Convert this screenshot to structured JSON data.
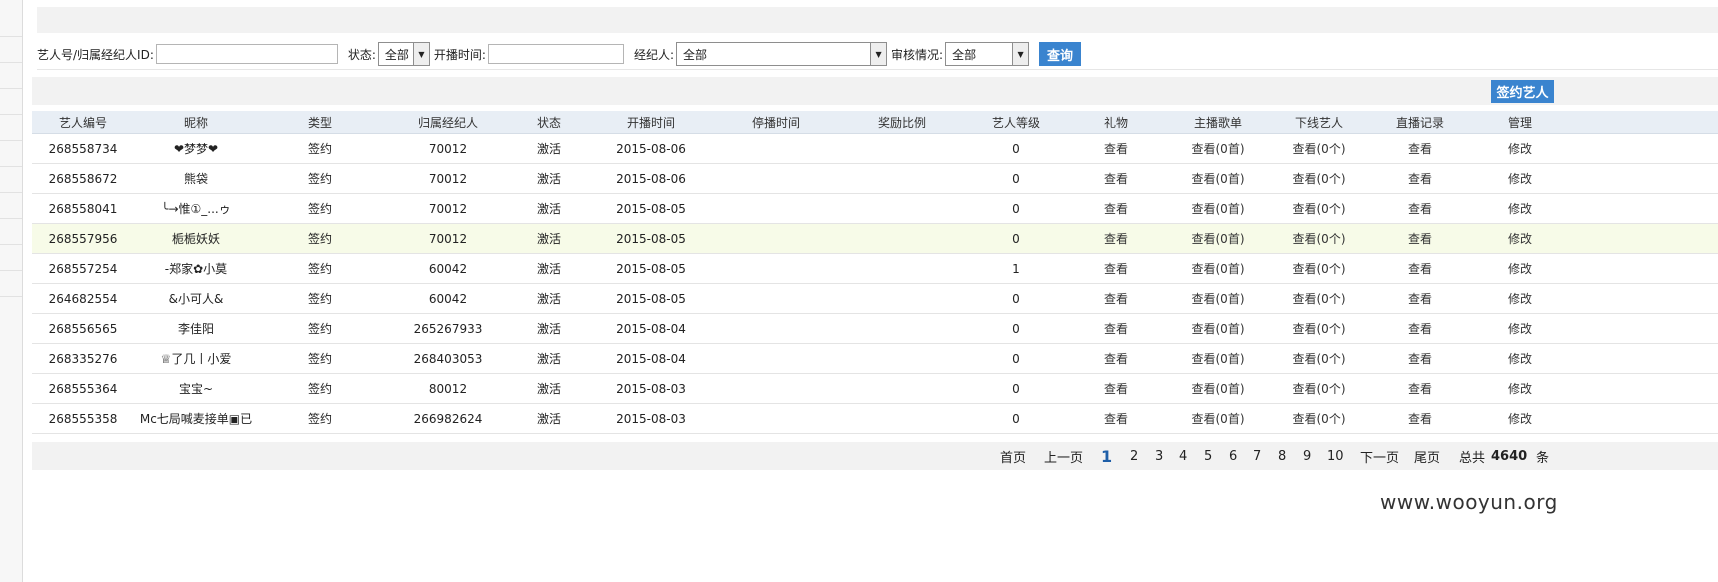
{
  "filters": {
    "artist_id_label": "艺人号/归属经纪人ID:",
    "artist_id_value": "",
    "status_label": "状态:",
    "status_value": "全部",
    "start_time_label": "开播时间:",
    "start_time_value": "",
    "agent_label": "经纪人:",
    "agent_value": "全部",
    "review_label": "审核情况:",
    "review_value": "全部",
    "query_label": "查询"
  },
  "actions": {
    "sign_artist_label": "签约艺人"
  },
  "table": {
    "headers": [
      "艺人编号",
      "昵称",
      "类型",
      "归属经纪人",
      "状态",
      "开播时间",
      "停播时间",
      "奖励比例",
      "艺人等级",
      "礼物",
      "主播歌单",
      "下线艺人",
      "直播记录",
      "管理"
    ],
    "rows": [
      [
        "268558734",
        "❤梦梦❤",
        "签约",
        "70012",
        "激活",
        "2015-08-06",
        "",
        "",
        "0",
        "查看",
        "查看(0首)",
        "查看(0个)",
        "查看",
        "修改"
      ],
      [
        "268558672",
        "熊袋",
        "签约",
        "70012",
        "激活",
        "2015-08-06",
        "",
        "",
        "0",
        "查看",
        "查看(0首)",
        "查看(0个)",
        "查看",
        "修改"
      ],
      [
        "268558041",
        "╰→惟①_...ゥ",
        "签约",
        "70012",
        "激活",
        "2015-08-05",
        "",
        "",
        "0",
        "查看",
        "查看(0首)",
        "查看(0个)",
        "查看",
        "修改"
      ],
      [
        "268557956",
        "栀栀妖妖",
        "签约",
        "70012",
        "激活",
        "2015-08-05",
        "",
        "",
        "0",
        "查看",
        "查看(0首)",
        "查看(0个)",
        "查看",
        "修改"
      ],
      [
        "268557254",
        "-郑家✿小莫",
        "签约",
        "60042",
        "激活",
        "2015-08-05",
        "",
        "",
        "1",
        "查看",
        "查看(0首)",
        "查看(0个)",
        "查看",
        "修改"
      ],
      [
        "264682554",
        "&小可人&",
        "签约",
        "60042",
        "激活",
        "2015-08-05",
        "",
        "",
        "0",
        "查看",
        "查看(0首)",
        "查看(0个)",
        "查看",
        "修改"
      ],
      [
        "268556565",
        "李佳阳",
        "签约",
        "265267933",
        "激活",
        "2015-08-04",
        "",
        "",
        "0",
        "查看",
        "查看(0首)",
        "查看(0个)",
        "查看",
        "修改"
      ],
      [
        "268335276",
        "♕了几丨小爱",
        "签约",
        "268403053",
        "激活",
        "2015-08-04",
        "",
        "",
        "0",
        "查看",
        "查看(0首)",
        "查看(0个)",
        "查看",
        "修改"
      ],
      [
        "268555364",
        "宝宝~",
        "签约",
        "80012",
        "激活",
        "2015-08-03",
        "",
        "",
        "0",
        "查看",
        "查看(0首)",
        "查看(0个)",
        "查看",
        "修改"
      ],
      [
        "268555358",
        "Mc七局喊麦接单▣已",
        "签约",
        "266982624",
        "激活",
        "2015-08-03",
        "",
        "",
        "0",
        "查看",
        "查看(0首)",
        "查看(0个)",
        "查看",
        "修改"
      ]
    ]
  },
  "pagination": {
    "first": "首页",
    "prev": "上一页",
    "pages": [
      "1",
      "2",
      "3",
      "4",
      "5",
      "6",
      "7",
      "8",
      "9",
      "10"
    ],
    "current": "1",
    "next": "下一页",
    "last": "尾页",
    "total_prefix": "总共",
    "total": "4640",
    "total_suffix": "条"
  },
  "watermark": "www.wooyun.org"
}
